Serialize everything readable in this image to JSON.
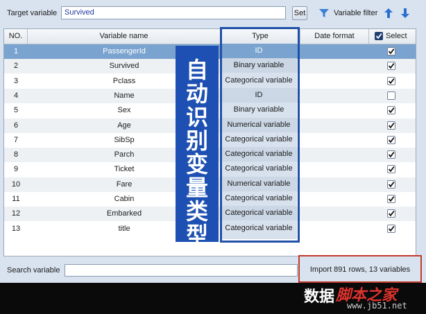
{
  "toolbar": {
    "target_label": "Target variable",
    "target_value": "Survived",
    "set_label": "Set",
    "filter_label": "Variable filter",
    "filter_icon": "funnel-icon",
    "move_up_icon": "arrow-up-icon",
    "move_down_icon": "arrow-down-icon"
  },
  "table": {
    "headers": {
      "no": "NO.",
      "name": "Variable name",
      "type": "Type",
      "date": "Date format",
      "select": "Select"
    },
    "header_select_checked": true,
    "rows": [
      {
        "no": "1",
        "name": "PassengerId",
        "type": "ID",
        "date": "",
        "checked": true,
        "selected": true
      },
      {
        "no": "2",
        "name": "Survived",
        "type": "Binary variable",
        "date": "",
        "checked": true
      },
      {
        "no": "3",
        "name": "Pclass",
        "type": "Categorical variable",
        "date": "",
        "checked": true
      },
      {
        "no": "4",
        "name": "Name",
        "type": "ID",
        "date": "",
        "checked": false
      },
      {
        "no": "5",
        "name": "Sex",
        "type": "Binary variable",
        "date": "",
        "checked": true
      },
      {
        "no": "6",
        "name": "Age",
        "type": "Numerical variable",
        "date": "",
        "checked": true
      },
      {
        "no": "7",
        "name": "SibSp",
        "type": "Categorical variable",
        "date": "",
        "checked": true
      },
      {
        "no": "8",
        "name": "Parch",
        "type": "Categorical variable",
        "date": "",
        "checked": true
      },
      {
        "no": "9",
        "name": "Ticket",
        "type": "Categorical variable",
        "date": "",
        "checked": true
      },
      {
        "no": "10",
        "name": "Fare",
        "type": "Numerical variable",
        "date": "",
        "checked": true
      },
      {
        "no": "11",
        "name": "Cabin",
        "type": "Categorical variable",
        "date": "",
        "checked": true
      },
      {
        "no": "12",
        "name": "Embarked",
        "type": "Categorical variable",
        "date": "",
        "checked": true
      },
      {
        "no": "13",
        "name": "title",
        "type": "Categorical variable",
        "date": "",
        "checked": true
      }
    ]
  },
  "annotation": {
    "text": "自动识别变量类型",
    "color": "#1d50b2"
  },
  "search": {
    "label": "Search variable",
    "value": ""
  },
  "status": {
    "text": "Import 891 rows, 13 variables",
    "highlight_color": "#c0392b"
  },
  "watermark": {
    "part1": "数据",
    "part2": "脚本之家",
    "url": "www.jb51.net"
  },
  "colors": {
    "accent": "#1e50a8",
    "selected_row": "#7aa3cf",
    "panel": "#d9e3ef"
  }
}
